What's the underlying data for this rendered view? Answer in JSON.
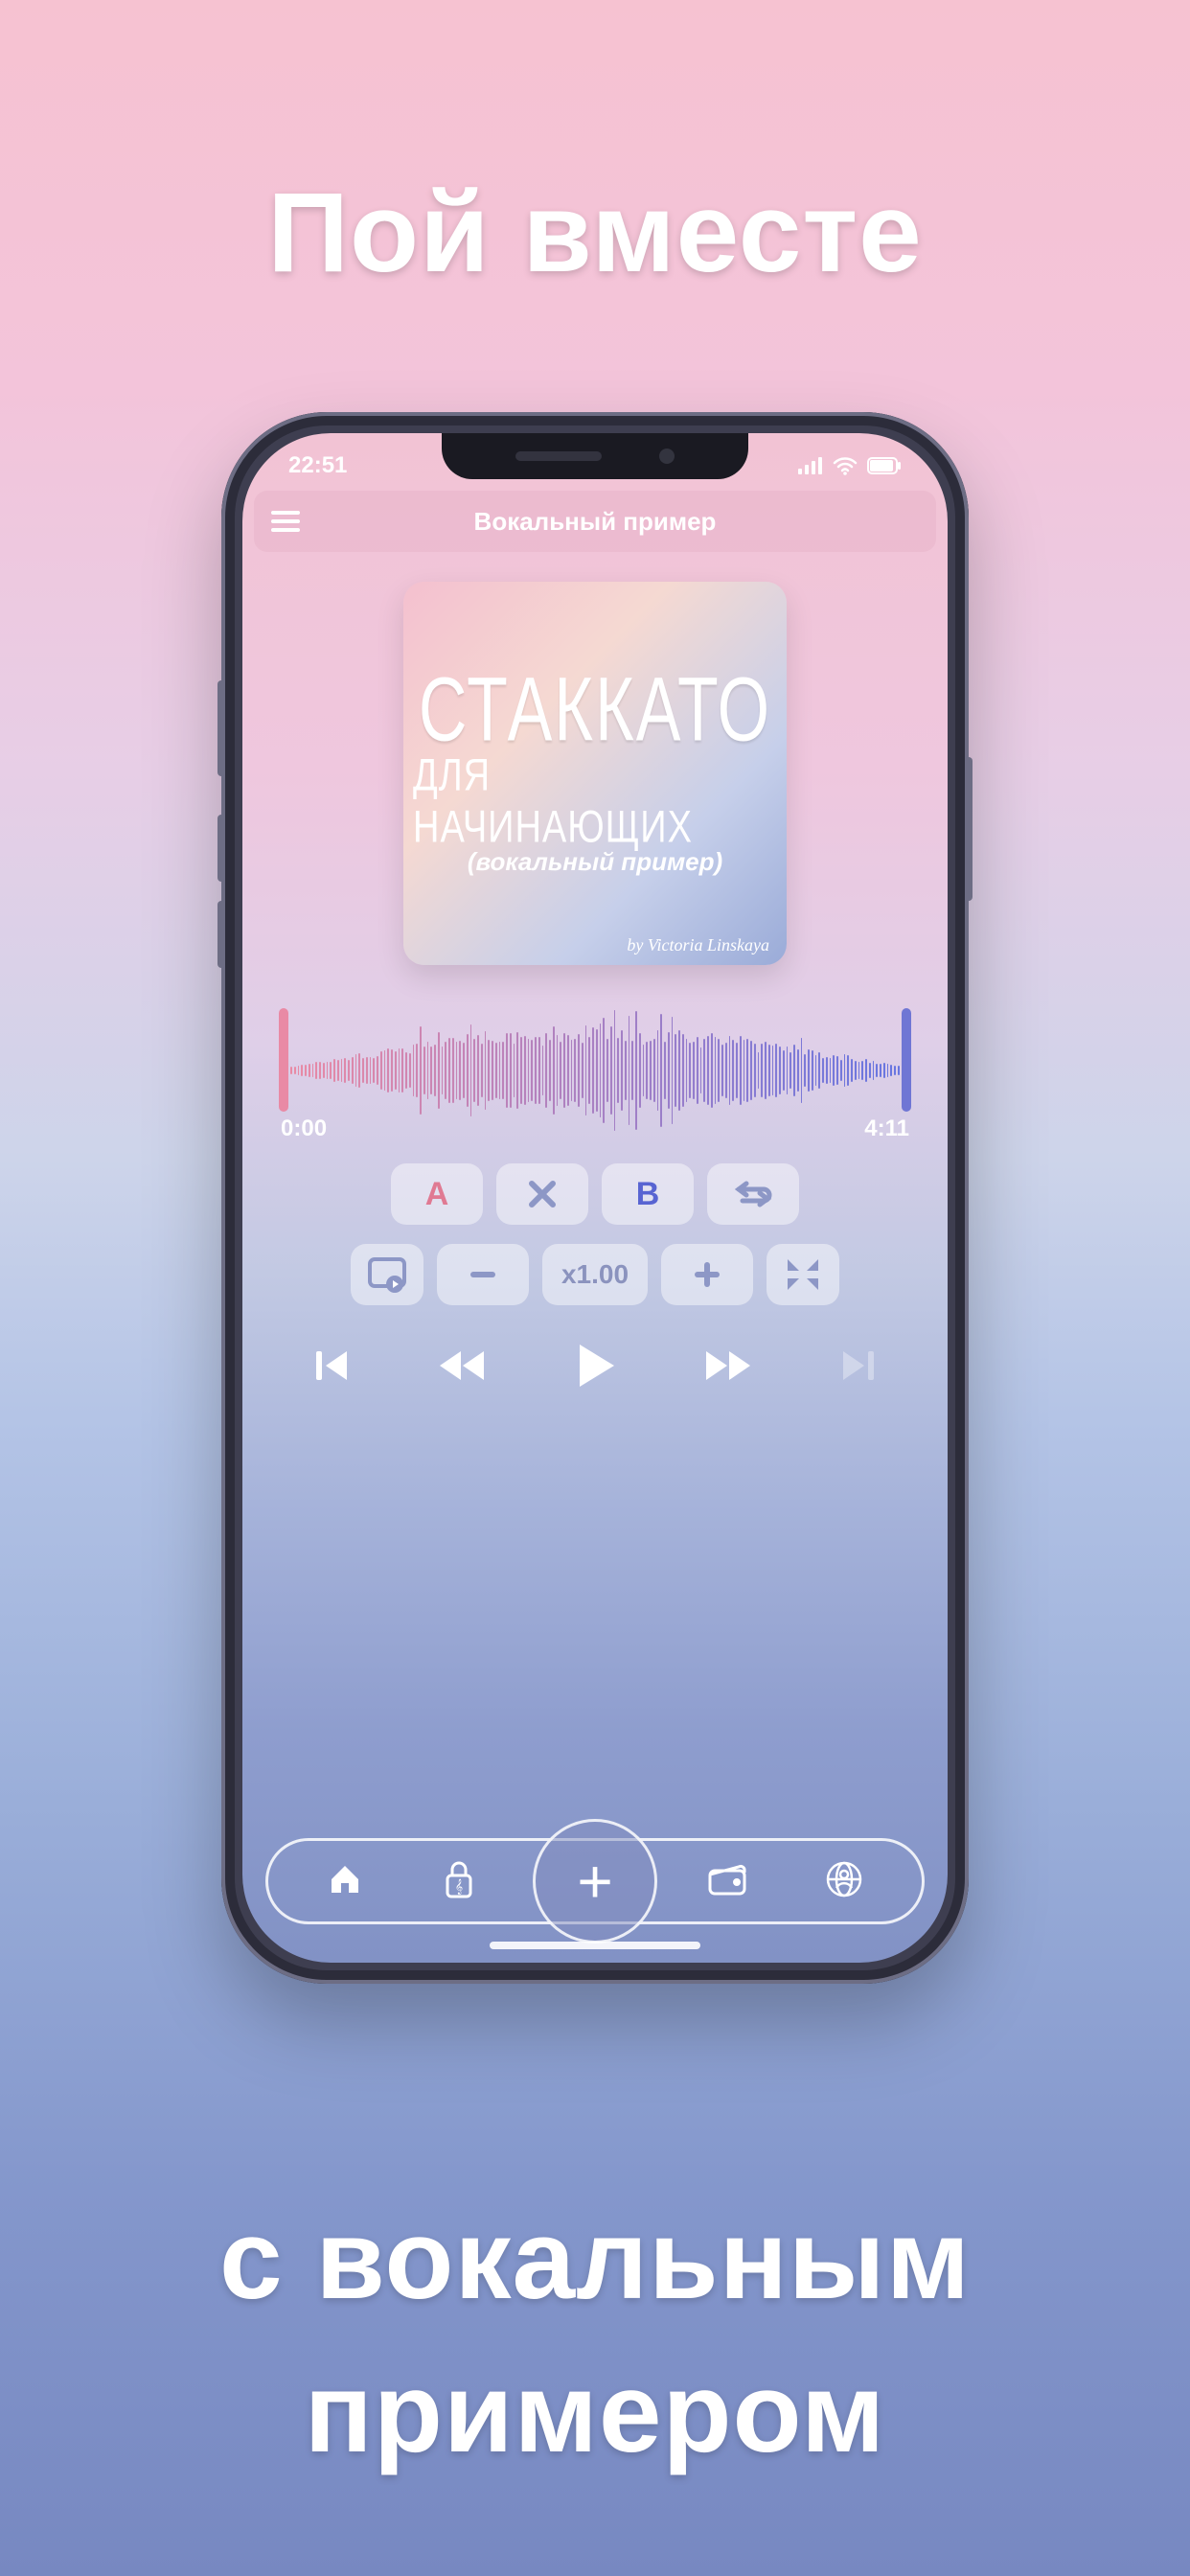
{
  "promo": {
    "top": "Пой вместе",
    "bottom1": "с вокальным",
    "bottom2": "примером"
  },
  "status": {
    "time": "22:51",
    "signal_icon": "cellular-icon",
    "wifi_icon": "wifi-icon",
    "battery_icon": "battery-icon"
  },
  "header": {
    "menu_icon": "hamburger-icon",
    "title": "Вокальный пример"
  },
  "album": {
    "line1": "СТАККАТО",
    "line2": "ДЛЯ НАЧИНАЮЩИХ",
    "line3": "(вокальный пример)",
    "byline": "by Victoria Linskaya"
  },
  "player": {
    "time_start": "0:00",
    "time_end": "4:11",
    "loop_a": "A",
    "loop_b": "B",
    "clear_icon": "x-icon",
    "repeat_icon": "repeat-icon",
    "pip_icon": "pip-return-icon",
    "minus_icon": "minus-icon",
    "speed": "x1.00",
    "plus_icon": "plus-icon",
    "collapse_icon": "collapse-icon",
    "prev_icon": "skip-back-icon",
    "rw_icon": "rewind-icon",
    "play_icon": "play-icon",
    "ff_icon": "fast-forward-icon",
    "next_icon": "skip-forward-icon"
  },
  "nav": {
    "home_icon": "home-icon",
    "lock_icon": "lock-music-icon",
    "add_icon": "plus-icon",
    "wallet_icon": "wallet-icon",
    "profile_icon": "profile-globe-icon"
  },
  "colors": {
    "accent_pink": "#e98aa5",
    "accent_blue": "#6f76d4",
    "chip_bg": "rgba(255,255,255,0.45)"
  }
}
